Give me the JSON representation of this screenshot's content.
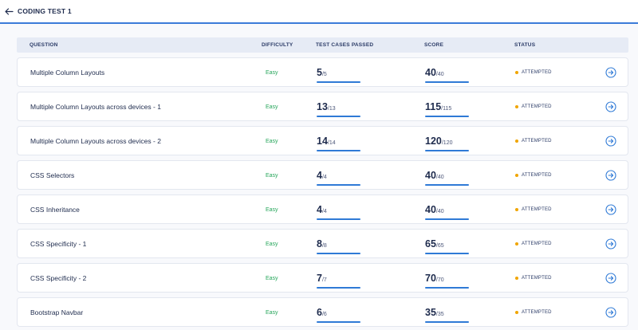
{
  "header": {
    "title": "CODING TEST 1",
    "back_icon": "arrow-left-icon"
  },
  "table": {
    "columns": {
      "question": "QUESTION",
      "difficulty": "DIFFICULTY",
      "test_cases": "TEST CASES PASSED",
      "score": "SCORE",
      "status": "STATUS"
    },
    "rows": [
      {
        "question": "Multiple Column Layouts",
        "difficulty": "Easy",
        "passed": "5",
        "passed_total": "/5",
        "passed_fraction": 1.0,
        "score": "40",
        "score_total": "/40",
        "score_fraction": 1.0,
        "status": "ATTEMPTED"
      },
      {
        "question": "Multiple Column Layouts across devices - 1",
        "difficulty": "Easy",
        "passed": "13",
        "passed_total": "/13",
        "passed_fraction": 1.0,
        "score": "115",
        "score_total": "/115",
        "score_fraction": 1.0,
        "status": "ATTEMPTED"
      },
      {
        "question": "Multiple Column Layouts across devices - 2",
        "difficulty": "Easy",
        "passed": "14",
        "passed_total": "/14",
        "passed_fraction": 1.0,
        "score": "120",
        "score_total": "/120",
        "score_fraction": 1.0,
        "status": "ATTEMPTED"
      },
      {
        "question": "CSS Selectors",
        "difficulty": "Easy",
        "passed": "4",
        "passed_total": "/4",
        "passed_fraction": 1.0,
        "score": "40",
        "score_total": "/40",
        "score_fraction": 1.0,
        "status": "ATTEMPTED"
      },
      {
        "question": "CSS Inheritance",
        "difficulty": "Easy",
        "passed": "4",
        "passed_total": "/4",
        "passed_fraction": 1.0,
        "score": "40",
        "score_total": "/40",
        "score_fraction": 1.0,
        "status": "ATTEMPTED"
      },
      {
        "question": "CSS Specificity - 1",
        "difficulty": "Easy",
        "passed": "8",
        "passed_total": "/8",
        "passed_fraction": 1.0,
        "score": "65",
        "score_total": "/65",
        "score_fraction": 1.0,
        "status": "ATTEMPTED"
      },
      {
        "question": "CSS Specificity - 2",
        "difficulty": "Easy",
        "passed": "7",
        "passed_total": "/7",
        "passed_fraction": 1.0,
        "score": "70",
        "score_total": "/70",
        "score_fraction": 1.0,
        "status": "ATTEMPTED"
      },
      {
        "question": "Bootstrap Navbar",
        "difficulty": "Easy",
        "passed": "6",
        "passed_total": "/6",
        "passed_fraction": 1.0,
        "score": "35",
        "score_total": "/35",
        "score_fraction": 1.0,
        "status": "ATTEMPTED"
      }
    ]
  },
  "colors": {
    "accent": "#3b7bd9",
    "bar_fill": "#2f7ad6",
    "easy": "#26a65b",
    "status_dot": "#f0a500",
    "text": "#1e2b4d"
  },
  "icons": {
    "row_action": "arrow-right-circle-icon"
  }
}
